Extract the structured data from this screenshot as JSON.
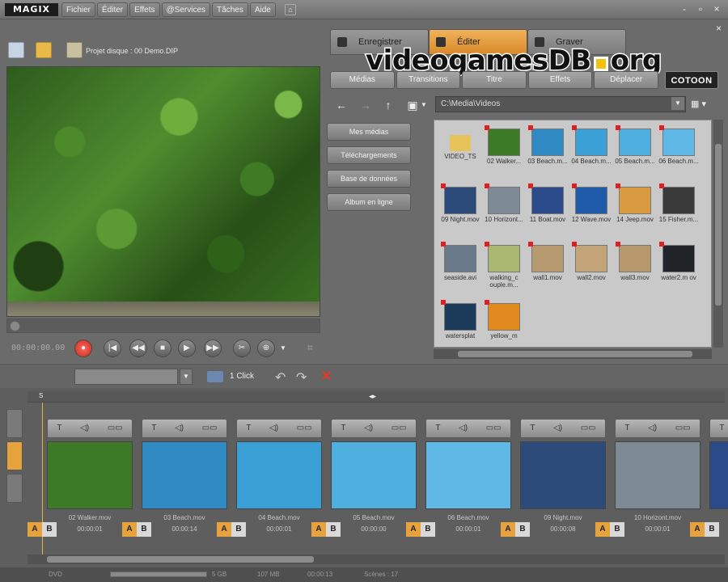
{
  "app": {
    "brand": "MAGIX"
  },
  "menu": [
    "Fichier",
    "Éditer",
    "Effets",
    "@Services",
    "Tâches",
    "Aide"
  ],
  "window_controls": [
    "-",
    "▫",
    "×"
  ],
  "toolbar": {
    "project_label": "Projet disque : 00 Demo.DIP"
  },
  "mode_tabs": [
    "Enregistrer",
    "Éditer",
    "Graver"
  ],
  "watermark": {
    "left": "videogamesDB",
    "right": "org"
  },
  "preview": {
    "timecode": "00:00:00.00",
    "progress": 0
  },
  "media_tabs": [
    "Médias",
    "Transitions",
    "Titre",
    "Effets",
    "Déplacer"
  ],
  "cotoon": "COTOON",
  "path": "C:\\Media\\Videos",
  "side_buttons": [
    "Mes médias",
    "Téléchargements",
    "Base de données",
    "Album en ligne"
  ],
  "media_items": [
    {
      "name": "VIDEO_TS",
      "type": "folder",
      "color": "#e8c25a"
    },
    {
      "name": "02 Walker...",
      "color": "#3d7a28"
    },
    {
      "name": "03 Beach.m...",
      "color": "#2f8ac4"
    },
    {
      "name": "04 Beach.m...",
      "color": "#3aa0d6"
    },
    {
      "name": "05 Beach.m...",
      "color": "#4fb0e0"
    },
    {
      "name": "06 Beach.m...",
      "color": "#5fb8e6"
    },
    {
      "name": "09 Night.mov",
      "color": "#2c4a7a"
    },
    {
      "name": "10 Horizont...",
      "color": "#7e8a96"
    },
    {
      "name": "11 Boat.mov",
      "color": "#2a4a8a"
    },
    {
      "name": "12 Wave.mov",
      "color": "#1e5aa8"
    },
    {
      "name": "14 Jeep.mov",
      "color": "#d99a40"
    },
    {
      "name": "15 Fisher.m...",
      "color": "#3a3a3a"
    },
    {
      "name": "seaside.avi",
      "color": "#6a7a8a"
    },
    {
      "name": "walking_c ouple.m...",
      "color": "#a8b870"
    },
    {
      "name": "wall1.mov",
      "color": "#b89a70"
    },
    {
      "name": "wall2.mov",
      "color": "#c2a478"
    },
    {
      "name": "wall3.mov",
      "color": "#b6986c"
    },
    {
      "name": "water2.m ov",
      "color": "#202428"
    },
    {
      "name": "watersplat",
      "color": "#1c3a5a"
    },
    {
      "name": "yellow_m",
      "color": "#e08a20"
    }
  ],
  "timeline_toolbar": {
    "oneclick": "1 Click",
    "undo": "↶",
    "redo": "↷",
    "delete": "✕"
  },
  "clips": [
    {
      "name": "02 Walker.mov",
      "time": "00:00:01",
      "color": "#3d7a28"
    },
    {
      "name": "03 Beach.mov",
      "time": "00:00:14",
      "color": "#2f8ac4"
    },
    {
      "name": "04 Beach.mov",
      "time": "00:00:01",
      "color": "#3aa0d6"
    },
    {
      "name": "05 Beach.mov",
      "time": "00:00:00",
      "color": "#4fb0e0"
    },
    {
      "name": "06 Beach.mov",
      "time": "00:00:01",
      "color": "#5fb8e6"
    },
    {
      "name": "09 Night.mov",
      "time": "00:00:08",
      "color": "#2c4a7a"
    },
    {
      "name": "10 Horizont.mov",
      "time": "00:00:01",
      "color": "#7e8a96"
    },
    {
      "name": "",
      "time": "",
      "color": "#2a4a8a"
    }
  ],
  "clip_tools": [
    "T",
    "◁)",
    "▭▭"
  ],
  "ab_labels": {
    "a": "A",
    "b": "B"
  },
  "status": {
    "left": "DVD",
    "size1": "5 GB",
    "size2": "107 MB",
    "duration": "00:00:13",
    "scenes": "Scènes : 17"
  }
}
